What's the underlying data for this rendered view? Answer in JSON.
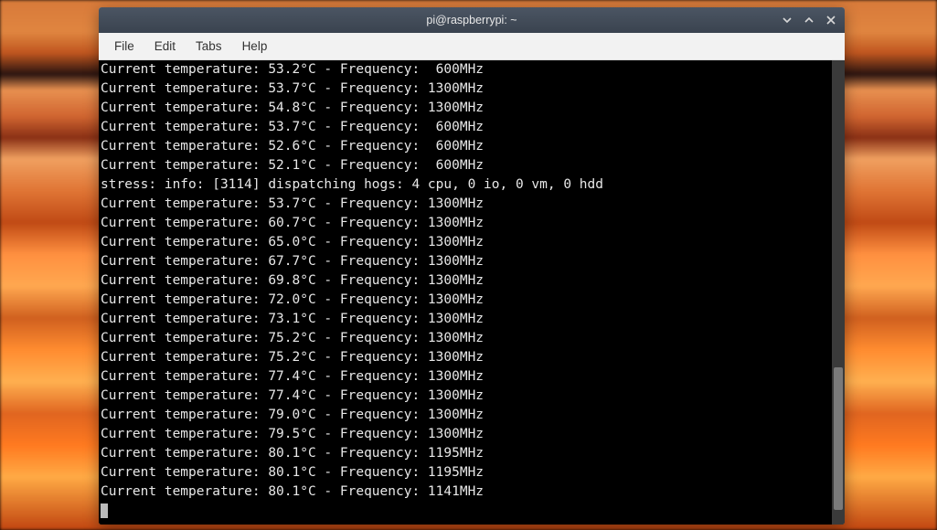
{
  "window": {
    "title": "pi@raspberrypi: ~"
  },
  "menus": {
    "file": "File",
    "edit": "Edit",
    "tabs": "Tabs",
    "help": "Help"
  },
  "terminal": {
    "prefix": "Current temperature: ",
    "freq_label": " - Frequency: ",
    "freq_unit": "MHz",
    "temp_unit": "°C",
    "lines": [
      {
        "type": "reading",
        "temp": "53.2",
        "freq": " 600"
      },
      {
        "type": "reading",
        "temp": "53.7",
        "freq": "1300"
      },
      {
        "type": "reading",
        "temp": "54.8",
        "freq": "1300"
      },
      {
        "type": "reading",
        "temp": "53.7",
        "freq": " 600"
      },
      {
        "type": "reading",
        "temp": "52.6",
        "freq": " 600"
      },
      {
        "type": "reading",
        "temp": "52.1",
        "freq": " 600"
      },
      {
        "type": "info",
        "text": "stress: info: [3114] dispatching hogs: 4 cpu, 0 io, 0 vm, 0 hdd"
      },
      {
        "type": "reading",
        "temp": "53.7",
        "freq": "1300"
      },
      {
        "type": "reading",
        "temp": "60.7",
        "freq": "1300"
      },
      {
        "type": "reading",
        "temp": "65.0",
        "freq": "1300"
      },
      {
        "type": "reading",
        "temp": "67.7",
        "freq": "1300"
      },
      {
        "type": "reading",
        "temp": "69.8",
        "freq": "1300"
      },
      {
        "type": "reading",
        "temp": "72.0",
        "freq": "1300"
      },
      {
        "type": "reading",
        "temp": "73.1",
        "freq": "1300"
      },
      {
        "type": "reading",
        "temp": "75.2",
        "freq": "1300"
      },
      {
        "type": "reading",
        "temp": "75.2",
        "freq": "1300"
      },
      {
        "type": "reading",
        "temp": "77.4",
        "freq": "1300"
      },
      {
        "type": "reading",
        "temp": "77.4",
        "freq": "1300"
      },
      {
        "type": "reading",
        "temp": "79.0",
        "freq": "1300"
      },
      {
        "type": "reading",
        "temp": "79.5",
        "freq": "1300"
      },
      {
        "type": "reading",
        "temp": "80.1",
        "freq": "1195"
      },
      {
        "type": "reading",
        "temp": "80.1",
        "freq": "1195"
      },
      {
        "type": "reading",
        "temp": "80.1",
        "freq": "1141"
      }
    ]
  }
}
